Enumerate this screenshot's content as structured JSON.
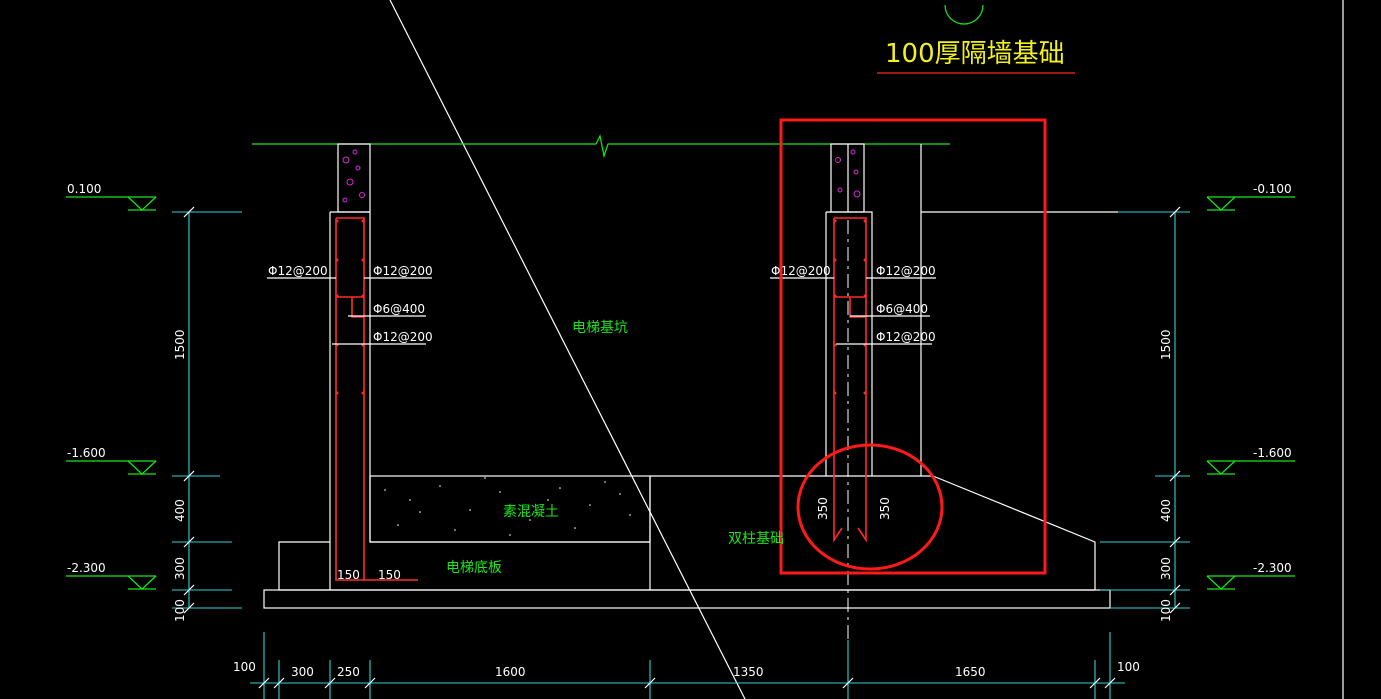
{
  "title": "100厚隔墙基础",
  "levels_left": [
    "0.100",
    "-1.600",
    "-2.300"
  ],
  "levels_right": [
    "-0.100",
    "-1.600",
    "-2.300"
  ],
  "vertical_dims_left": [
    "1500",
    "400",
    "300",
    "100"
  ],
  "vertical_dims_right": [
    "1500",
    "400",
    "300",
    "100"
  ],
  "horizontal_dims": [
    "100",
    "300",
    "250",
    "1600",
    "1350",
    "1650",
    "100"
  ],
  "rebar_left": {
    "outer_top": "Φ12@200",
    "inner_top": "Φ12@200",
    "stirrup": "Φ6@400",
    "inner_bottom": "Φ12@200",
    "anchor_a": "150",
    "anchor_b": "150"
  },
  "rebar_right": {
    "outer_top": "Φ12@200",
    "inner_top": "Φ12@200",
    "stirrup": "Φ6@400",
    "inner_bottom": "Φ12@200",
    "anchor_a": "350",
    "anchor_b": "350"
  },
  "labels": {
    "pit": "电梯基坑",
    "plain_concrete": "素混凝土",
    "pit_slab": "电梯底板",
    "double_column_foundation": "双柱基础"
  },
  "colors": {
    "background": "#000000",
    "lines": "#ffffff",
    "annotation": "#19e619",
    "dimension": "#2fd3d3",
    "rebar": "#ff2a2a",
    "highlight": "#ff1a1a",
    "title": "#f2f21a"
  }
}
